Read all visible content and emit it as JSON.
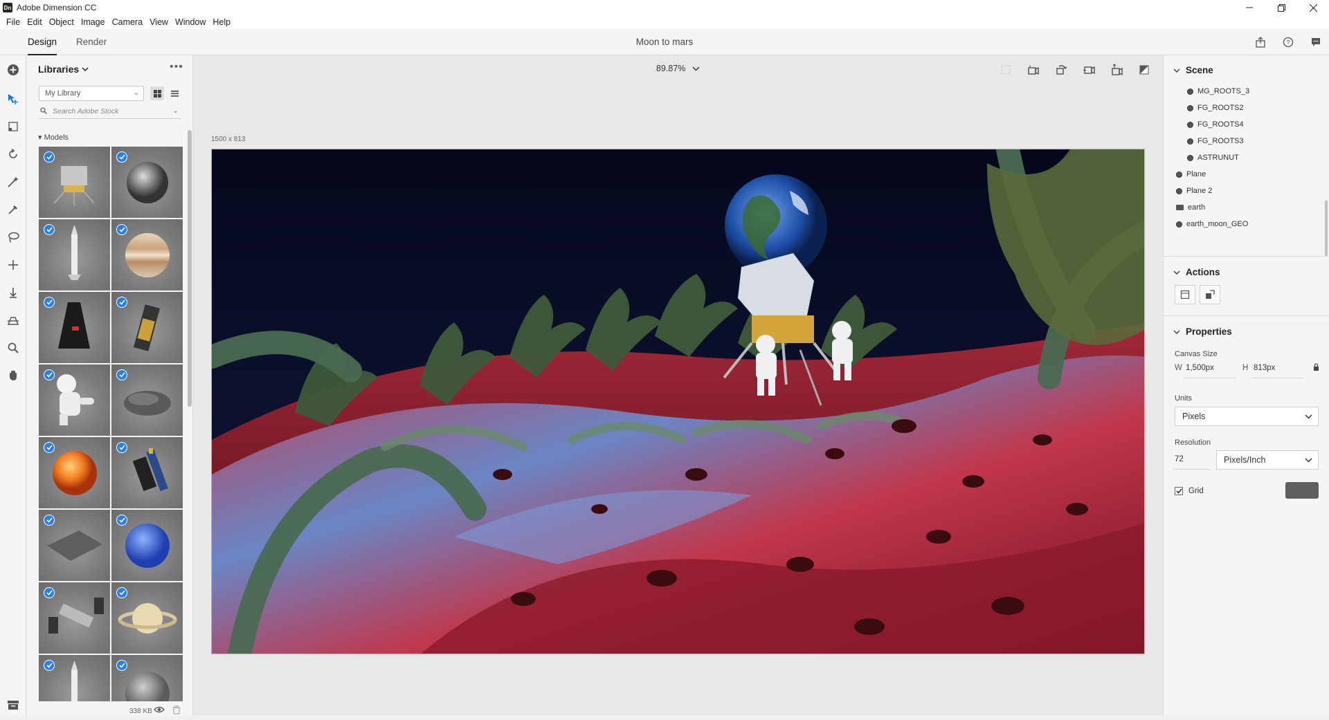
{
  "window": {
    "title": "Adobe Dimension CC",
    "logo": "Dn",
    "controls": [
      "minimize-icon",
      "restore-icon",
      "close-icon"
    ]
  },
  "menu": [
    "File",
    "Edit",
    "Object",
    "Image",
    "Camera",
    "View",
    "Window",
    "Help"
  ],
  "modes": {
    "design": "Design",
    "render": "Render"
  },
  "document_title": "Moon to mars",
  "libraries": {
    "header": "Libraries",
    "library_select": "My Library",
    "search_placeholder": "Search Adobe Stock",
    "section": "Models",
    "footer_size": "338 KB",
    "models": [
      "lunar-lander",
      "asteroid-rock",
      "rocket",
      "jupiter",
      "capsule",
      "satellite",
      "astronaut",
      "rock",
      "sun",
      "space-telescope",
      "ground-plane",
      "neptune",
      "space-station",
      "saturn",
      "rocket-2",
      "moon"
    ]
  },
  "canvas": {
    "zoom": "89.87%",
    "dimensions": "1500 x 813"
  },
  "scene": {
    "header": "Scene",
    "items": [
      {
        "name": "MG_ROOTS_3",
        "type": "model",
        "level": 1
      },
      {
        "name": "FG_ROOTS2",
        "type": "model",
        "level": 1
      },
      {
        "name": "FG_ROOTS4",
        "type": "model",
        "level": 1
      },
      {
        "name": "FG_ROOTS3",
        "type": "model",
        "level": 1
      },
      {
        "name": "ASTRUNUT",
        "type": "model",
        "level": 1
      },
      {
        "name": "Plane",
        "type": "model",
        "level": 0
      },
      {
        "name": "Plane 2",
        "type": "model",
        "level": 0
      },
      {
        "name": "earth",
        "type": "group",
        "level": 0
      },
      {
        "name": "earth_moon_GEO",
        "type": "model",
        "level": 0
      }
    ]
  },
  "actions": {
    "header": "Actions"
  },
  "properties": {
    "header": "Properties",
    "canvas_size_label": "Canvas Size",
    "w_label": "W",
    "width": "1,500px",
    "h_label": "H",
    "height": "813px",
    "units_label": "Units",
    "units": "Pixels",
    "resolution_label": "Resolution",
    "resolution": "72",
    "resolution_unit": "Pixels/Inch",
    "grid_label": "Grid",
    "grid_checked": true,
    "grid_color": "#5e5e5e"
  },
  "colors": {
    "accent": "#2680eb",
    "panel": "#f5f5f5",
    "canvas_bg": "#e8e8e8"
  }
}
